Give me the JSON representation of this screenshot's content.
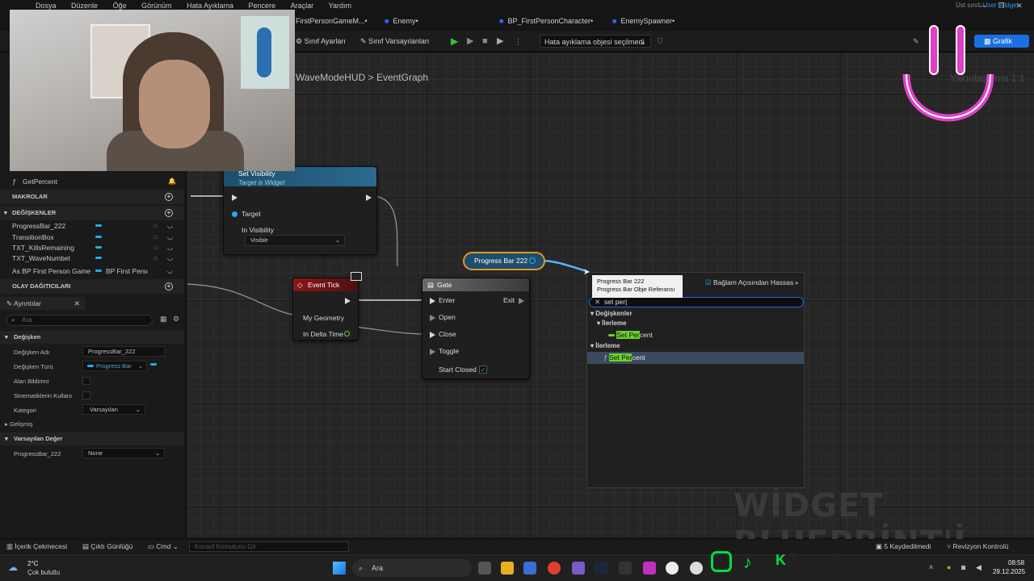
{
  "menu": [
    "Dosya",
    "Düzenle",
    "Öğe",
    "Görünüm",
    "Hata Ayıklama",
    "Pencere",
    "Araçlar",
    "Yardım"
  ],
  "tabs": [
    {
      "label": "FirstPersonGameM...•"
    },
    {
      "label": "Enemy•"
    },
    {
      "label": "BP_FirstPersonCharacter•"
    },
    {
      "label": "EnemySpawner•"
    }
  ],
  "parent_class": {
    "label": "Üst sınıf:",
    "value": "User Widget"
  },
  "toolbar": {
    "class_settings": "Sınıf Ayarları",
    "class_defaults": "Sınıf Varsayılanları",
    "debug_object": "Hata ayıklama objesi seçilmedi",
    "graph_button": "Grafik"
  },
  "breadcrumb": {
    "widget": "WaveModeHUD",
    "separator": ">",
    "graph": "EventGraph"
  },
  "zoom_label": "Yakınlaştırma 1:1",
  "functions": {
    "items": [
      "GetPercent"
    ]
  },
  "sections": {
    "macros": "MAKROLAR",
    "variables": "DEĞİŞKENLER",
    "dispatchers": "OLAY DAĞITICILARI"
  },
  "variables": [
    {
      "name": "ProgressBar_222"
    },
    {
      "name": "TransitionBox"
    },
    {
      "name": "TXT_KillsRemaining"
    },
    {
      "name": "TXT_WaveNumbet"
    },
    {
      "name": "As BP First Person Game I",
      "type": "BP First Perso"
    }
  ],
  "details": {
    "tab": "Ayrıntılar",
    "search_placeholder": "Ara",
    "section_variable": "Değişken",
    "var_name_label": "Değişken Adı",
    "var_name_value": "ProgressBar_222",
    "var_type_label": "Değişken Türü",
    "var_type_value": "Progress Bar",
    "field_notify_label": "Alan Bildirimi",
    "cinematics_label": "Sinematiklerin Kullanı",
    "category_label": "Kategori",
    "category_value": "Varsayılan",
    "advanced": "Gelişmiş",
    "section_default": "Varsayılan Değer",
    "default_label": "ProgressBar_222",
    "default_value": "None"
  },
  "nodes": {
    "set_visibility": {
      "title": "Set Visibility",
      "subtitle": "Target is Widget",
      "target": "Target",
      "in_visibility": "In Visibility",
      "visibility_value": "Visible"
    },
    "event_tick": {
      "title": "Event Tick",
      "geometry": "My Geometry",
      "delta": "In Delta Time"
    },
    "gate": {
      "title": "Gate",
      "enter": "Enter",
      "exit": "Exit",
      "open": "Open",
      "close": "Close",
      "toggle": "Toggle",
      "start_closed": "Start Closed"
    },
    "progress_bar": {
      "title": "Progress Bar 222"
    }
  },
  "tooltip": {
    "line1": "Progress Bar 222",
    "line2": "Progress Bar Obje Referansı"
  },
  "action_menu": {
    "context_label": "Bağlam Açısından Hassas",
    "search_value": "set per|",
    "cat_variables": "Değişkenler",
    "sub_progress": "İlerleme",
    "item1_hl": "Set Per",
    "item1_rest": "cent",
    "cat_progress": "İlerleme",
    "item2_hl": "Set Per",
    "item2_rest": "cent"
  },
  "watermark": "WİDGET BLUEPRİNT'İ",
  "statusbar": {
    "content_drawer": "İçerik Çekmecesi",
    "output_log": "Çıktı Günlüğü",
    "cmd": "Cmd",
    "console_placeholder": "Konsol Komutunu Gir",
    "unsaved": "5 Kaydedilmedi",
    "revision": "Revizyon Kontrolü"
  },
  "taskbar": {
    "weather_temp": "2°C",
    "weather_desc": "Çok bulutlu",
    "search": "Ara",
    "time": "08:58",
    "date": "29.12.2025"
  },
  "colors": {
    "accent": "#1a6fe0",
    "pin_blue": "#19b0ee",
    "event_red": "#8a1616",
    "node_blue": "#1e4e6e",
    "highlight_green": "#6ccf2e"
  }
}
